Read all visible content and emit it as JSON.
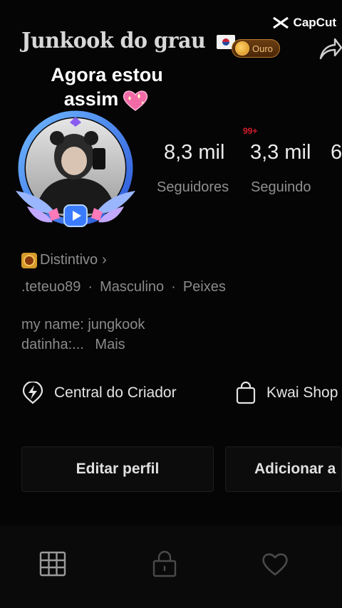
{
  "watermark": {
    "label": "CapCut"
  },
  "header": {
    "username": "Junkook do grau",
    "badge_label": "Ouro"
  },
  "overlay": {
    "line1": "Agora estou",
    "line2": "assim"
  },
  "notification": {
    "count": "99+"
  },
  "stats": [
    {
      "value": "8,3 mil",
      "label": "Seguidores"
    },
    {
      "value": "3,3 mil",
      "label": "Seguindo"
    },
    {
      "value": "6",
      "label": ""
    }
  ],
  "badge": {
    "label": "Distintivo",
    "chevron": "›"
  },
  "info": {
    "handle": ".teteuo89",
    "gender": "Masculino",
    "sign": "Peixes",
    "separator": "·"
  },
  "bio": {
    "line1": "my name: jungkook",
    "line2": "datinha:...",
    "more": "Mais"
  },
  "links": [
    {
      "label": "Central do Criador",
      "icon": "lightning-icon"
    },
    {
      "label": "Kwai Shop",
      "icon": "shopping-bag-icon"
    }
  ],
  "buttons": {
    "edit_profile": "Editar perfil",
    "add": "Adicionar a"
  },
  "tabs": [
    {
      "icon": "grid-icon"
    },
    {
      "icon": "lock-icon"
    },
    {
      "icon": "heart-icon"
    }
  ],
  "colors": {
    "background": "#050505",
    "notification": "#d81c2c",
    "gold": "#d49a2c",
    "frame_blue": "#2f7df0"
  }
}
